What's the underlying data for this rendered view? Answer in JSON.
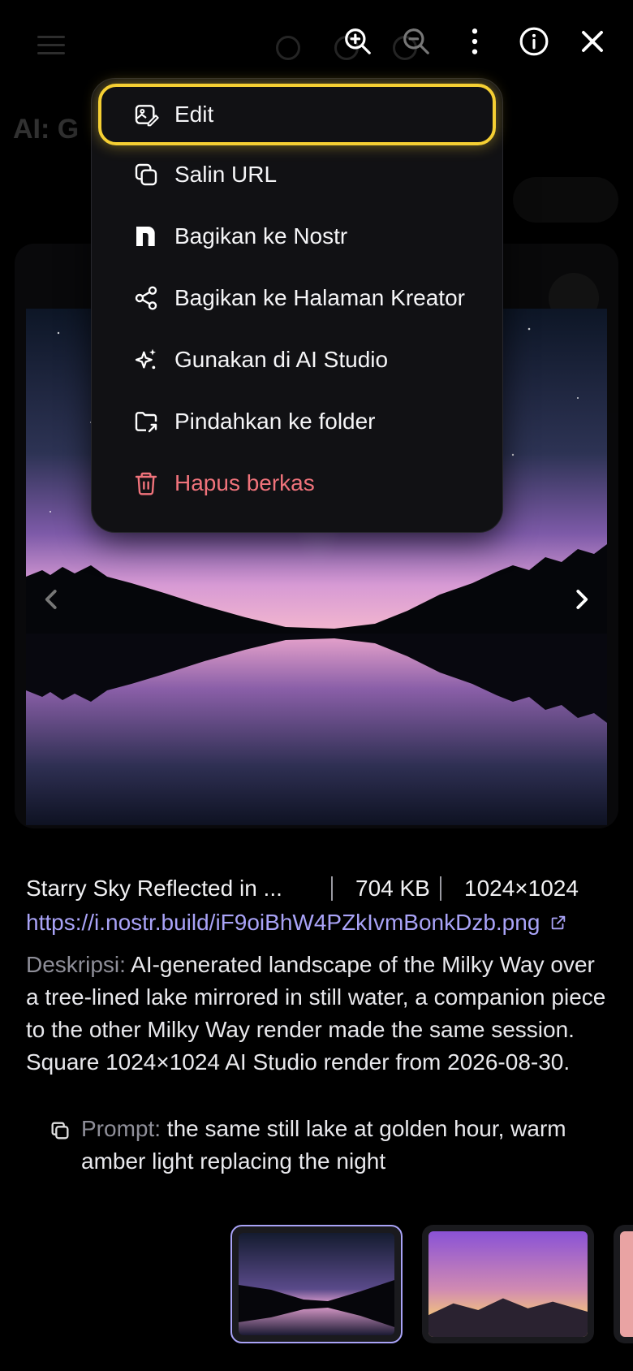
{
  "toolbar": {
    "zoom_in": "zoom-in-icon",
    "zoom_out": "zoom-out-icon",
    "more": "more-vertical-icon",
    "info": "info-icon",
    "close": "close-icon"
  },
  "menu": {
    "items": [
      {
        "label": "Edit",
        "icon": "edit-image-icon"
      },
      {
        "label": "Salin URL",
        "icon": "copy-icon"
      },
      {
        "label": "Bagikan ke Nostr",
        "icon": "nostr-icon"
      },
      {
        "label": "Bagikan ke Halaman Kreator",
        "icon": "share-icon"
      },
      {
        "label": "Gunakan di AI Studio",
        "icon": "sparkles-icon"
      },
      {
        "label": "Pindahkan ke folder",
        "icon": "folder-move-icon"
      },
      {
        "label": "Hapus berkas",
        "icon": "trash-icon"
      }
    ]
  },
  "image": {
    "title": "Starry Sky Reflected in ...",
    "size": "704 KB",
    "dimensions": "1024×1024",
    "url": "https://i.nostr.build/iF9oiBhW4PZkIvmBonkDzb.png"
  },
  "description": {
    "label": "Deskripsi:",
    "text": " AI-generated landscape of the Milky Way over a tree-lined lake mirrored in still water, a companion piece to the other Milky Way render made the same session. Square 1024×1024 AI Studio render from 2026-08-30."
  },
  "prompt": {
    "label": "Prompt:",
    "text": " the same still lake at golden hour, warm amber light replacing the night"
  },
  "colors": {
    "accent": "#a9a3f7",
    "focus_ring": "#f5cf33",
    "danger": "#f0737b",
    "menu_bg": "#111114"
  }
}
